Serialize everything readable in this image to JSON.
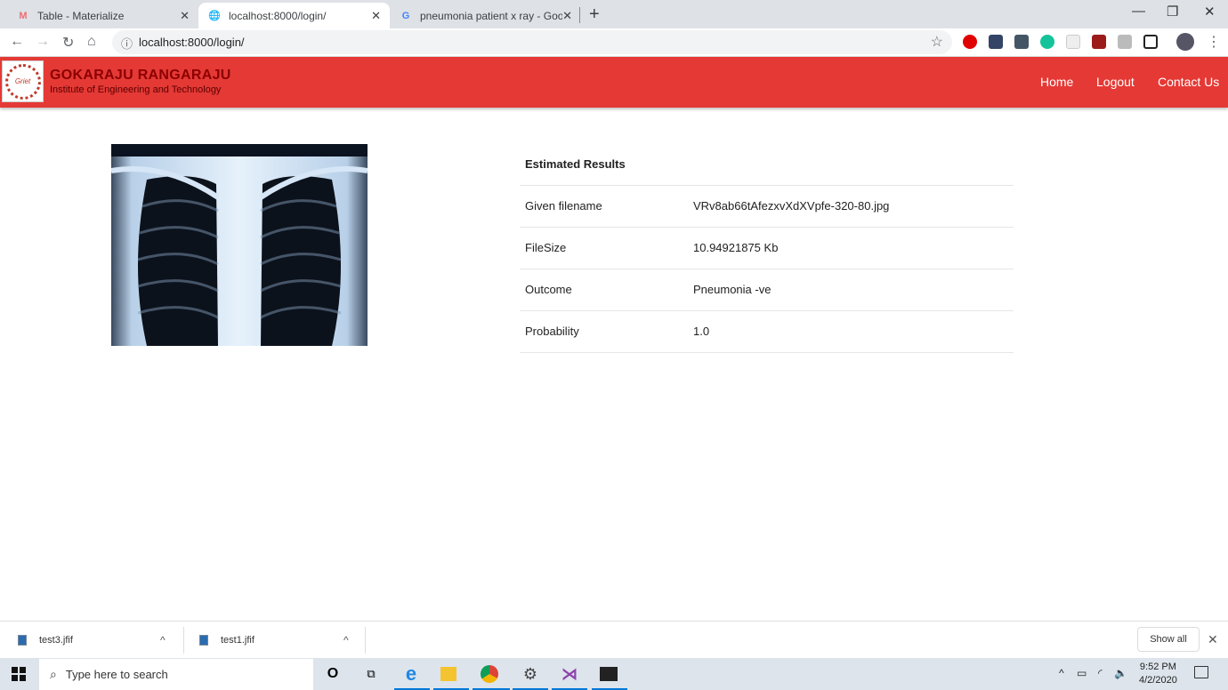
{
  "browser": {
    "tabs": [
      {
        "title": "Table - Materialize",
        "icon": "materialize-icon",
        "active": false
      },
      {
        "title": "localhost:8000/login/",
        "icon": "globe-icon",
        "active": true
      },
      {
        "title": "pneumonia patient x ray - Googl",
        "icon": "google-icon",
        "active": false
      }
    ],
    "close_glyph": "✕",
    "newtab_glyph": "+",
    "window_controls": {
      "minimize": "—",
      "maximize": "❐",
      "close": "✕"
    },
    "nav": {
      "back": "←",
      "forward": "→",
      "reload": "↻",
      "home": "⌂"
    },
    "url": "localhost:8000/login/",
    "info_glyph": "ⓘ",
    "star_glyph": "☆",
    "menu_glyph": "⋮",
    "extensions": [
      {
        "name": "opera-adblock-icon",
        "color": "#e00000"
      },
      {
        "name": "fb-extension-icon",
        "color": "#334466"
      },
      {
        "name": "new-tab-icon",
        "color": "#445566"
      },
      {
        "name": "grammarly-icon",
        "color": "#15c39a"
      },
      {
        "name": "mi-extension-icon",
        "color": "#e8e8e8"
      },
      {
        "name": "acrobat-icon",
        "color": "#9b1b1b"
      },
      {
        "name": "cast-icon",
        "color": "#888888"
      },
      {
        "name": "picture-in-picture-icon",
        "color": "#222222"
      }
    ]
  },
  "site": {
    "brand_name": "GOKARAJU RANGARAJU",
    "brand_sub": "Institute of Engineering and Technology",
    "logo_text": "Griet",
    "nav": [
      "Home",
      "Logout",
      "Contact Us"
    ],
    "accent": "#e53935"
  },
  "results": {
    "heading": "Estimated Results",
    "rows": [
      {
        "label": "Given filename",
        "value": "VRv8ab66tAfezxvXdXVpfe-320-80.jpg"
      },
      {
        "label": "FileSize",
        "value": "10.94921875 Kb"
      },
      {
        "label": "Outcome",
        "value": "Pneumonia -ve"
      },
      {
        "label": "Probability",
        "value": "1.0"
      }
    ]
  },
  "downloads": {
    "items": [
      {
        "name": "test3.jfif"
      },
      {
        "name": "test1.jfif"
      }
    ],
    "chevron": "^",
    "show_all": "Show all",
    "close": "✕"
  },
  "taskbar": {
    "search_placeholder": "Type here to search",
    "search_glyph": "⌕",
    "time": "9:52 PM",
    "date": "4/2/2020"
  }
}
